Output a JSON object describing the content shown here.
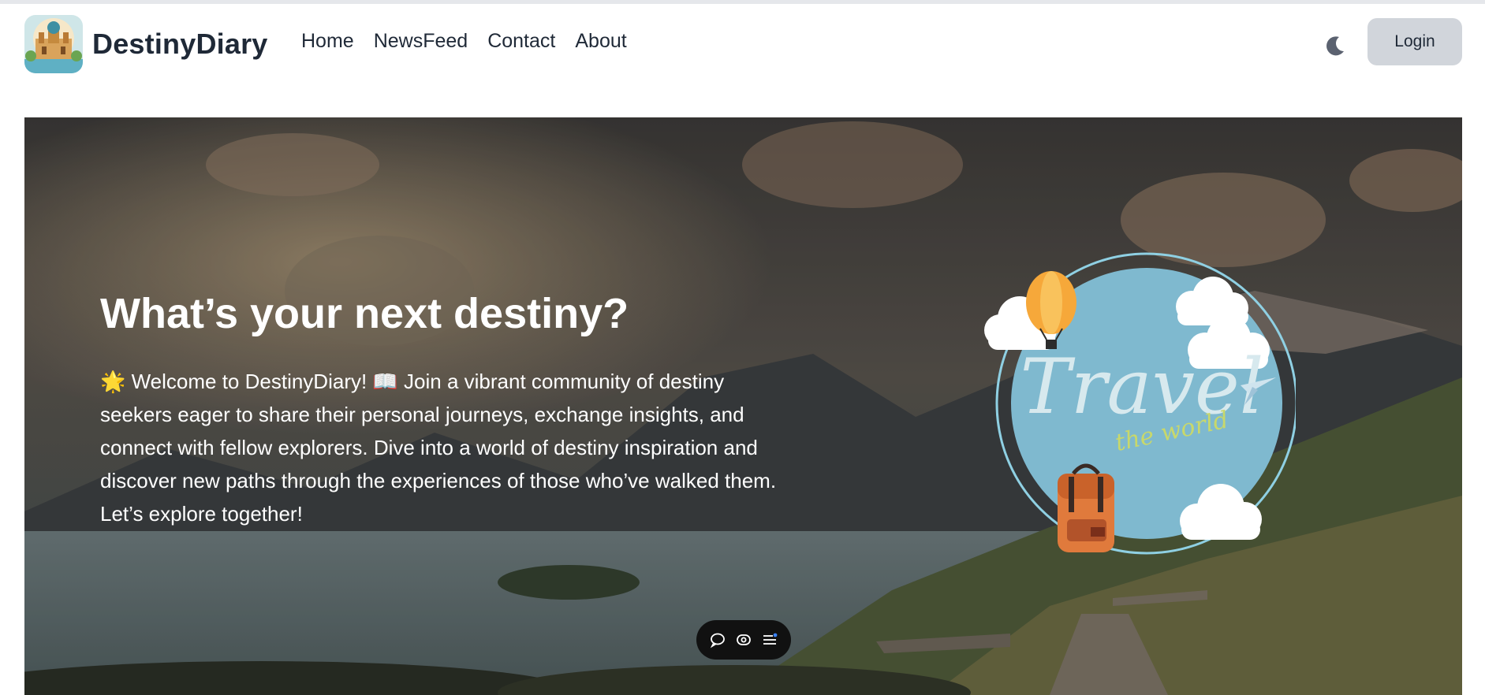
{
  "header": {
    "brand": "DestinyDiary",
    "nav": [
      "Home",
      "NewsFeed",
      "Contact",
      "About"
    ],
    "login_label": "Login",
    "theme_icon": "moon-icon"
  },
  "hero": {
    "title": "What’s your next destiny?",
    "description": "🌟 Welcome to DestinyDiary! 📖 Join a vibrant community of destiny seekers eager to share their personal journeys, exchange insights, and connect with fellow explorers. Dive into a world of destiny inspiration and discover new paths through the experiences of those who’ve walked them. Let’s explore together!",
    "badge": {
      "script_text": "Travel",
      "sub_text": "the world"
    }
  },
  "toolbar": {
    "icons": [
      "comment-icon",
      "eye-icon",
      "list-icon"
    ]
  },
  "colors": {
    "badge_circle": "#7fb9cf",
    "login_bg": "#d1d5db",
    "text_dark": "#1f2937"
  }
}
